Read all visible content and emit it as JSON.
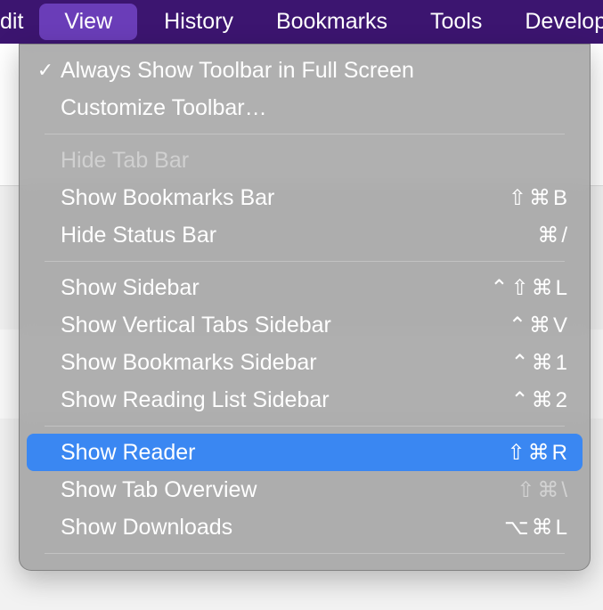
{
  "menubar": {
    "edit_partial": "dit",
    "view": "View",
    "history": "History",
    "bookmarks": "Bookmarks",
    "tools": "Tools",
    "develop_partial": "Develop"
  },
  "menu": {
    "always_show_toolbar": {
      "label": "Always Show Toolbar in Full Screen",
      "checked": true
    },
    "customize_toolbar": {
      "label": "Customize Toolbar…"
    },
    "hide_tab_bar": {
      "label": "Hide Tab Bar",
      "disabled": true
    },
    "show_bookmarks_bar": {
      "label": "Show Bookmarks Bar",
      "shortcut": "⇧⌘B"
    },
    "hide_status_bar": {
      "label": "Hide Status Bar",
      "shortcut": "⌘/"
    },
    "show_sidebar": {
      "label": "Show Sidebar",
      "shortcut": "⌃⇧⌘L"
    },
    "show_vertical_tabs_sidebar": {
      "label": "Show Vertical Tabs Sidebar",
      "shortcut": "⌃⌘V"
    },
    "show_bookmarks_sidebar": {
      "label": "Show Bookmarks Sidebar",
      "shortcut": "⌃⌘1"
    },
    "show_reading_list_sidebar": {
      "label": "Show Reading List Sidebar",
      "shortcut": "⌃⌘2"
    },
    "show_reader": {
      "label": "Show Reader",
      "shortcut": "⇧⌘R",
      "highlighted": true
    },
    "show_tab_overview": {
      "label": "Show Tab Overview",
      "shortcut": "⇧⌘\\",
      "shortcut_disabled": true
    },
    "show_downloads": {
      "label": "Show Downloads",
      "shortcut": "⌥⌘L"
    }
  }
}
